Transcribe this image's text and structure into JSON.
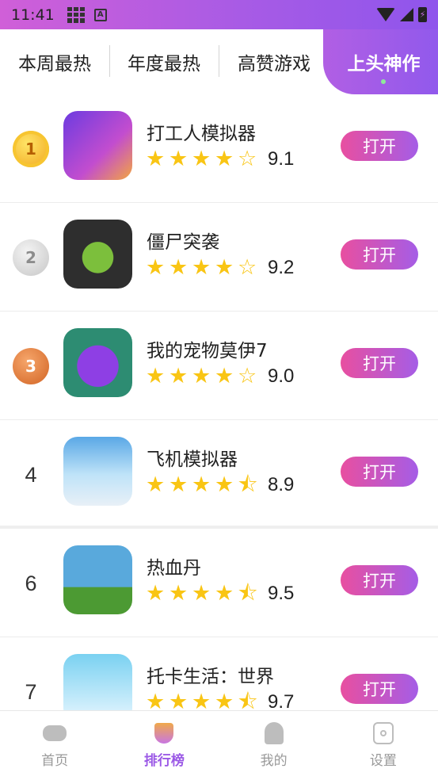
{
  "status_bar": {
    "time": "11:41",
    "a_badge": "A",
    "battery_glyph": "⚡"
  },
  "tabs": [
    {
      "label": "本周最热",
      "active": false
    },
    {
      "label": "年度最热",
      "active": false
    },
    {
      "label": "高赞游戏",
      "active": false
    },
    {
      "label": "上头神作",
      "active": true
    }
  ],
  "rows": [
    {
      "rank": "1",
      "rank_style": "gold",
      "name": "打工人模拟器",
      "rating": 4,
      "score": "9.1",
      "button": "打开",
      "icon": "game-icon-runner"
    },
    {
      "rank": "2",
      "rank_style": "silver",
      "name": "僵尸突袭",
      "rating": 4,
      "score": "9.2",
      "button": "打开",
      "icon": "game-icon-zombie"
    },
    {
      "rank": "3",
      "rank_style": "bronze",
      "name": "我的宠物莫伊7",
      "rating": 4,
      "score": "9.0",
      "button": "打开",
      "icon": "game-icon-moy"
    },
    {
      "rank": "4",
      "rank_style": "number",
      "name": "飞机模拟器",
      "rating": 4.5,
      "score": "8.9",
      "button": "打开",
      "icon": "game-icon-airplane"
    },
    {
      "rank": "6",
      "rank_style": "number",
      "name": "热血丹",
      "rating": 4.5,
      "score": "9.5",
      "button": "打开",
      "icon": "game-icon-dan"
    },
    {
      "rank": "7",
      "rank_style": "number",
      "name": "托卡生活：世界",
      "rating": 4.5,
      "score": "9.7",
      "button": "打开",
      "icon": "game-icon-toca"
    }
  ],
  "bottom_nav": [
    {
      "label": "首页",
      "icon": "gamepad-icon",
      "active": false
    },
    {
      "label": "排行榜",
      "icon": "trophy-icon",
      "active": true
    },
    {
      "label": "我的",
      "icon": "ghost-icon",
      "active": false
    },
    {
      "label": "设置",
      "icon": "settings-icon",
      "active": false
    }
  ],
  "colors": {
    "accent": "#9b59e6",
    "button_start": "#e84fa0",
    "button_end": "#a55de6",
    "star": "#f9c514"
  }
}
